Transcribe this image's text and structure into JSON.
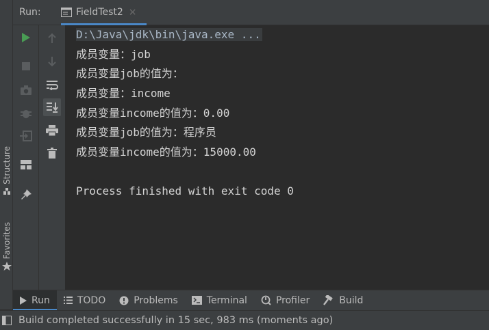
{
  "header": {
    "run_label": "Run:",
    "tab_title": "FieldTest2",
    "close_glyph": "×"
  },
  "left_stripe": {
    "structure_label": "Structure",
    "favorites_label": "Favorites"
  },
  "console": {
    "lines": [
      "D:\\Java\\jdk\\bin\\java.exe ...",
      "成员变量：job",
      "成员变量job的值为：",
      "成员变量：income",
      "成员变量income的值为：0.00",
      "成员变量job的值为：程序员",
      "成员变量income的值为：15000.00",
      "",
      "Process finished with exit code 0"
    ]
  },
  "toolbar_icons": {
    "col1": [
      "run-icon",
      "stop-icon",
      "camera-icon",
      "debug-icon",
      "exit-icon",
      "layout-icon",
      "pin-icon"
    ],
    "col2": [
      "up-arrow-icon",
      "down-arrow-icon",
      "soft-wrap-icon",
      "scroll-to-end-icon",
      "print-icon",
      "trash-icon"
    ]
  },
  "bottom_tabs": [
    {
      "label": "Run",
      "icon": "play-icon",
      "selected": true
    },
    {
      "label": "TODO",
      "icon": "list-icon",
      "selected": false
    },
    {
      "label": "Problems",
      "icon": "problems-icon",
      "selected": false
    },
    {
      "label": "Terminal",
      "icon": "terminal-icon",
      "selected": false
    },
    {
      "label": "Profiler",
      "icon": "profiler-icon",
      "selected": false
    },
    {
      "label": "Build",
      "icon": "hammer-icon",
      "selected": false
    }
  ],
  "status": {
    "text": "Build completed successfully in 15 sec, 983 ms (moments ago)"
  },
  "colors": {
    "run_green": "#499c54",
    "accent_blue": "#4a88c7",
    "console_bg": "#2b2b2b",
    "panel_bg": "#3c3f41"
  }
}
